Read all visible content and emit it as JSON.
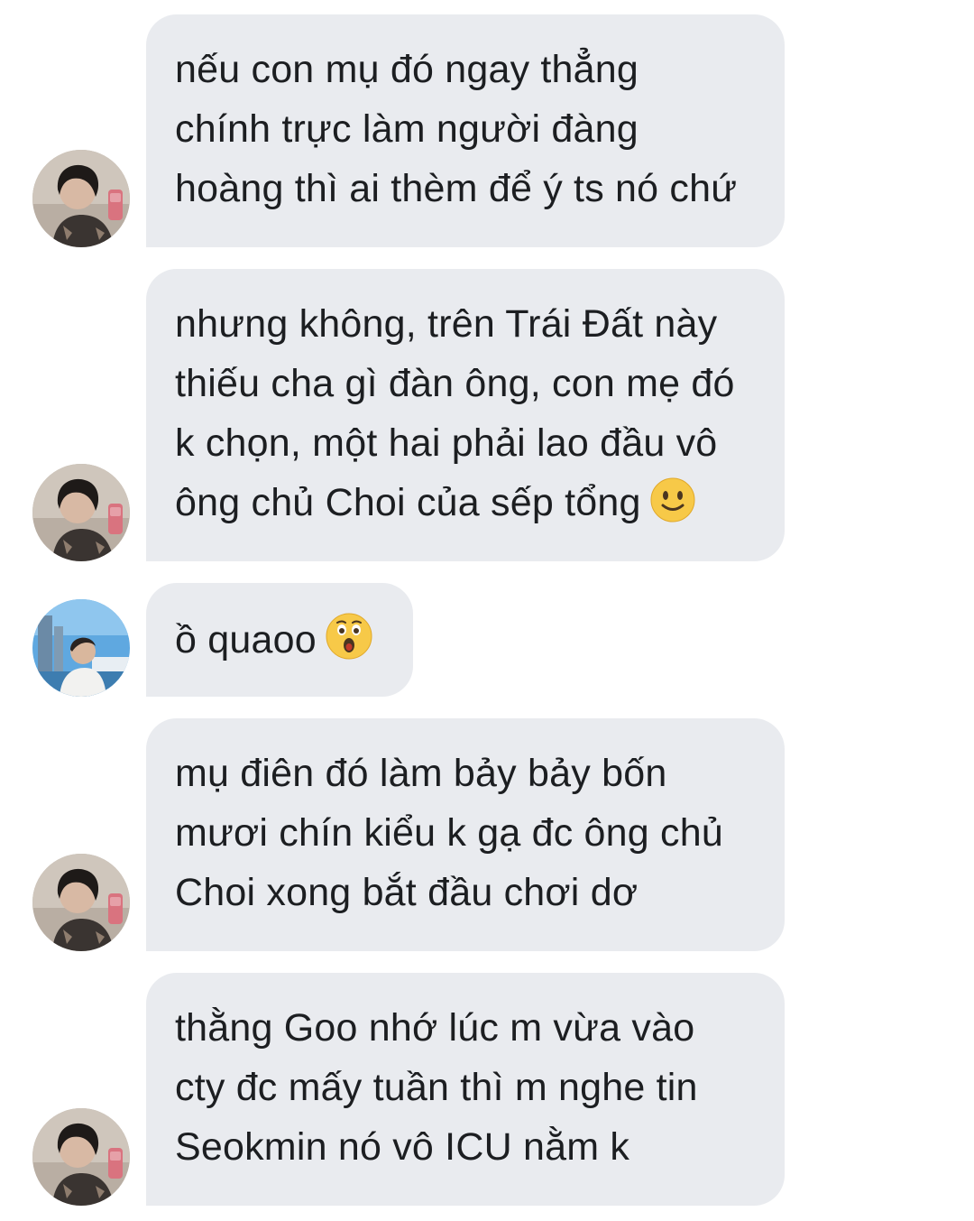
{
  "messages": [
    {
      "sender": "friend-a",
      "lines": [
        "nếu con mụ đó ngay thẳng",
        "chính trực làm người đàng",
        "hoàng thì ai thèm để ý ts nó chứ"
      ]
    },
    {
      "sender": "friend-a",
      "lines": [
        "nhưng không, trên Trái Đất này",
        "thiếu cha gì đàn ông, con mẹ đó",
        "k chọn, một hai phải lao đầu vô",
        "ông chủ Choi của sếp tổng"
      ],
      "emoji": "slightly-smiling-face-emoji"
    },
    {
      "sender": "friend-b",
      "lines": [
        "ồ quaoo"
      ],
      "emoji": "hushed-face-emoji"
    },
    {
      "sender": "friend-a",
      "lines": [
        "mụ điên đó làm bảy bảy bốn",
        "mươi chín kiểu k gạ đc ông chủ",
        "Choi xong bắt đầu chơi dơ"
      ]
    },
    {
      "sender": "friend-a",
      "lines": [
        "thằng Goo nhớ lúc m vừa vào",
        "cty đc mấy tuần thì m nghe tin",
        "Seokmin nó vô ICU nằm k"
      ]
    }
  ],
  "colors": {
    "bubble_bg": "#e9ebef",
    "text": "#1c1e21",
    "page_bg": "#ffffff"
  }
}
